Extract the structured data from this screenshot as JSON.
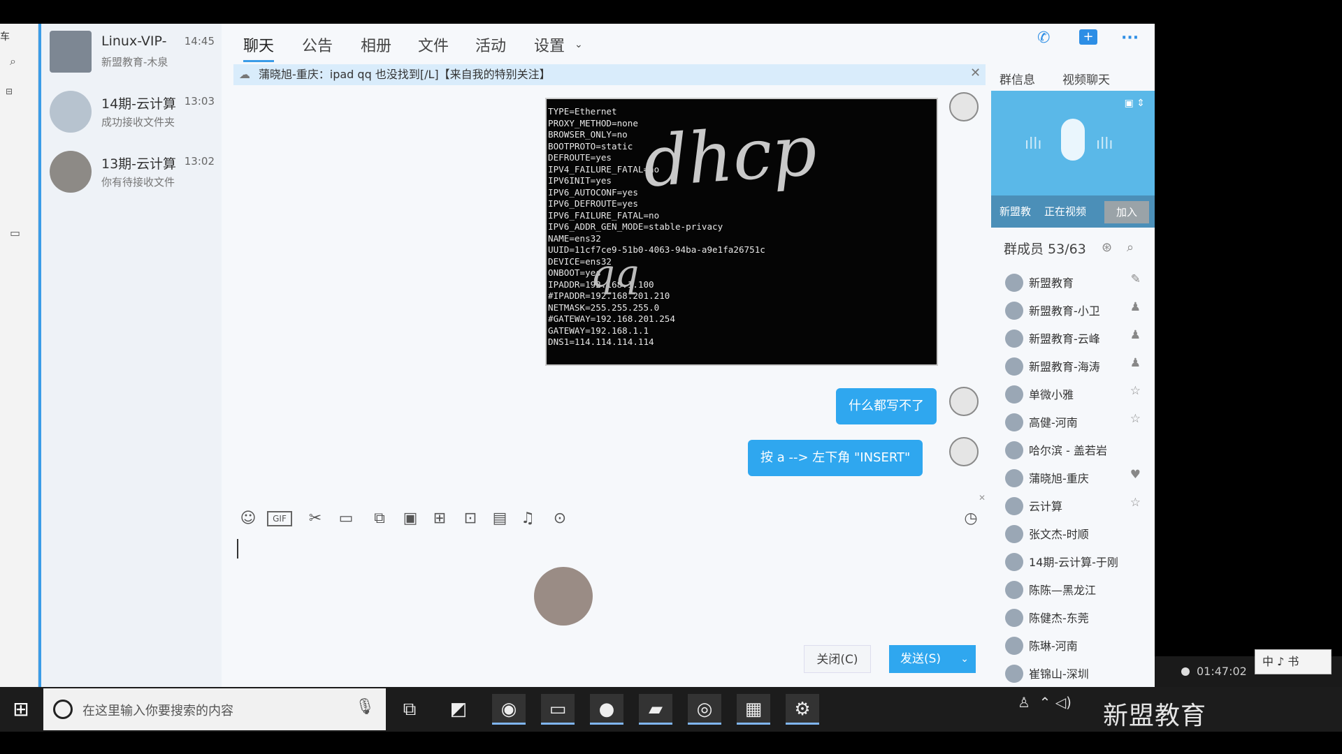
{
  "left_strip": {
    "text": "车"
  },
  "contacts": [
    {
      "name": "Linux-VIP-",
      "time": "14:45",
      "snippet": "新盟教育-木泉"
    },
    {
      "name": "14期-云计算",
      "time": "13:03",
      "snippet": "成功接收文件夹"
    },
    {
      "name": "13期-云计算",
      "time": "13:02",
      "snippet": "你有待接收文件"
    }
  ],
  "tabs": [
    "聊天",
    "公告",
    "相册",
    "文件",
    "活动",
    "设置"
  ],
  "top_icons": [
    "phone-icon",
    "add-member-icon",
    "more-icon"
  ],
  "notice": "蒲晓旭-重庆：ipad qq 也没找到[/L]【来自我的特别关注】",
  "terminal_lines": [
    "TYPE=Ethernet",
    "PROXY_METHOD=none",
    "BROWSER_ONLY=no",
    "BOOTPROTO=static",
    "DEFROUTE=yes",
    "IPV4_FAILURE_FATAL=no",
    "IPV6INIT=yes",
    "IPV6_AUTOCONF=yes",
    "IPV6_DEFROUTE=yes",
    "IPV6_FAILURE_FATAL=no",
    "IPV6_ADDR_GEN_MODE=stable-privacy",
    "NAME=ens32",
    "UUID=11cf7ce9-51b0-4063-94ba-a9e1fa26751c",
    "DEVICE=ens32",
    "ONBOOT=yes",
    "IPADDR=192.168.1.100",
    "#IPADDR=192.168.201.210",
    "NETMASK=255.255.255.0",
    "#GATEWAY=192.168.201.254",
    "GATEWAY=192.168.1.1",
    "DNS1=114.114.114.114"
  ],
  "scribbles": {
    "dhcp": "dhcp",
    "qq": "qq"
  },
  "messages": [
    {
      "text": "什么都写不了"
    },
    {
      "text": "按 a --> 左下角 \"INSERT\""
    }
  ],
  "toolbar_icons": [
    "emoji-icon",
    "gif-icon",
    "scissors-icon",
    "folder-icon",
    "screenshot-icon",
    "image-icon",
    "video-icon",
    "gift-icon",
    "clipboard-icon",
    "bell-icon",
    "more-icon"
  ],
  "buttons": {
    "close": "关闭(C)",
    "send": "发送(S)"
  },
  "side_tabs": [
    "群信息",
    "视频聊天"
  ],
  "video": {
    "owner": "新盟教",
    "status": "正在视频",
    "join": "加入"
  },
  "members_header": "群成员 53/63",
  "members": [
    "新盟教育",
    "新盟教育-小卫",
    "新盟教育-云峰",
    "新盟教育-海涛",
    "单微小雅",
    "高健-河南",
    "哈尔滨 - 盖若岩",
    "蒲晓旭-重庆",
    "云计算",
    "张文杰-时顺",
    "14期-云计算-于刚",
    "陈陈—黑龙江",
    "陈健杰-东莞",
    "陈琳-河南",
    "崔锦山-深圳"
  ],
  "taskbar": {
    "search_placeholder": "在这里输入你要搜索的内容",
    "brand": "新盟教育"
  },
  "clock": "01:47:02",
  "ime": "中 ♪ 书"
}
